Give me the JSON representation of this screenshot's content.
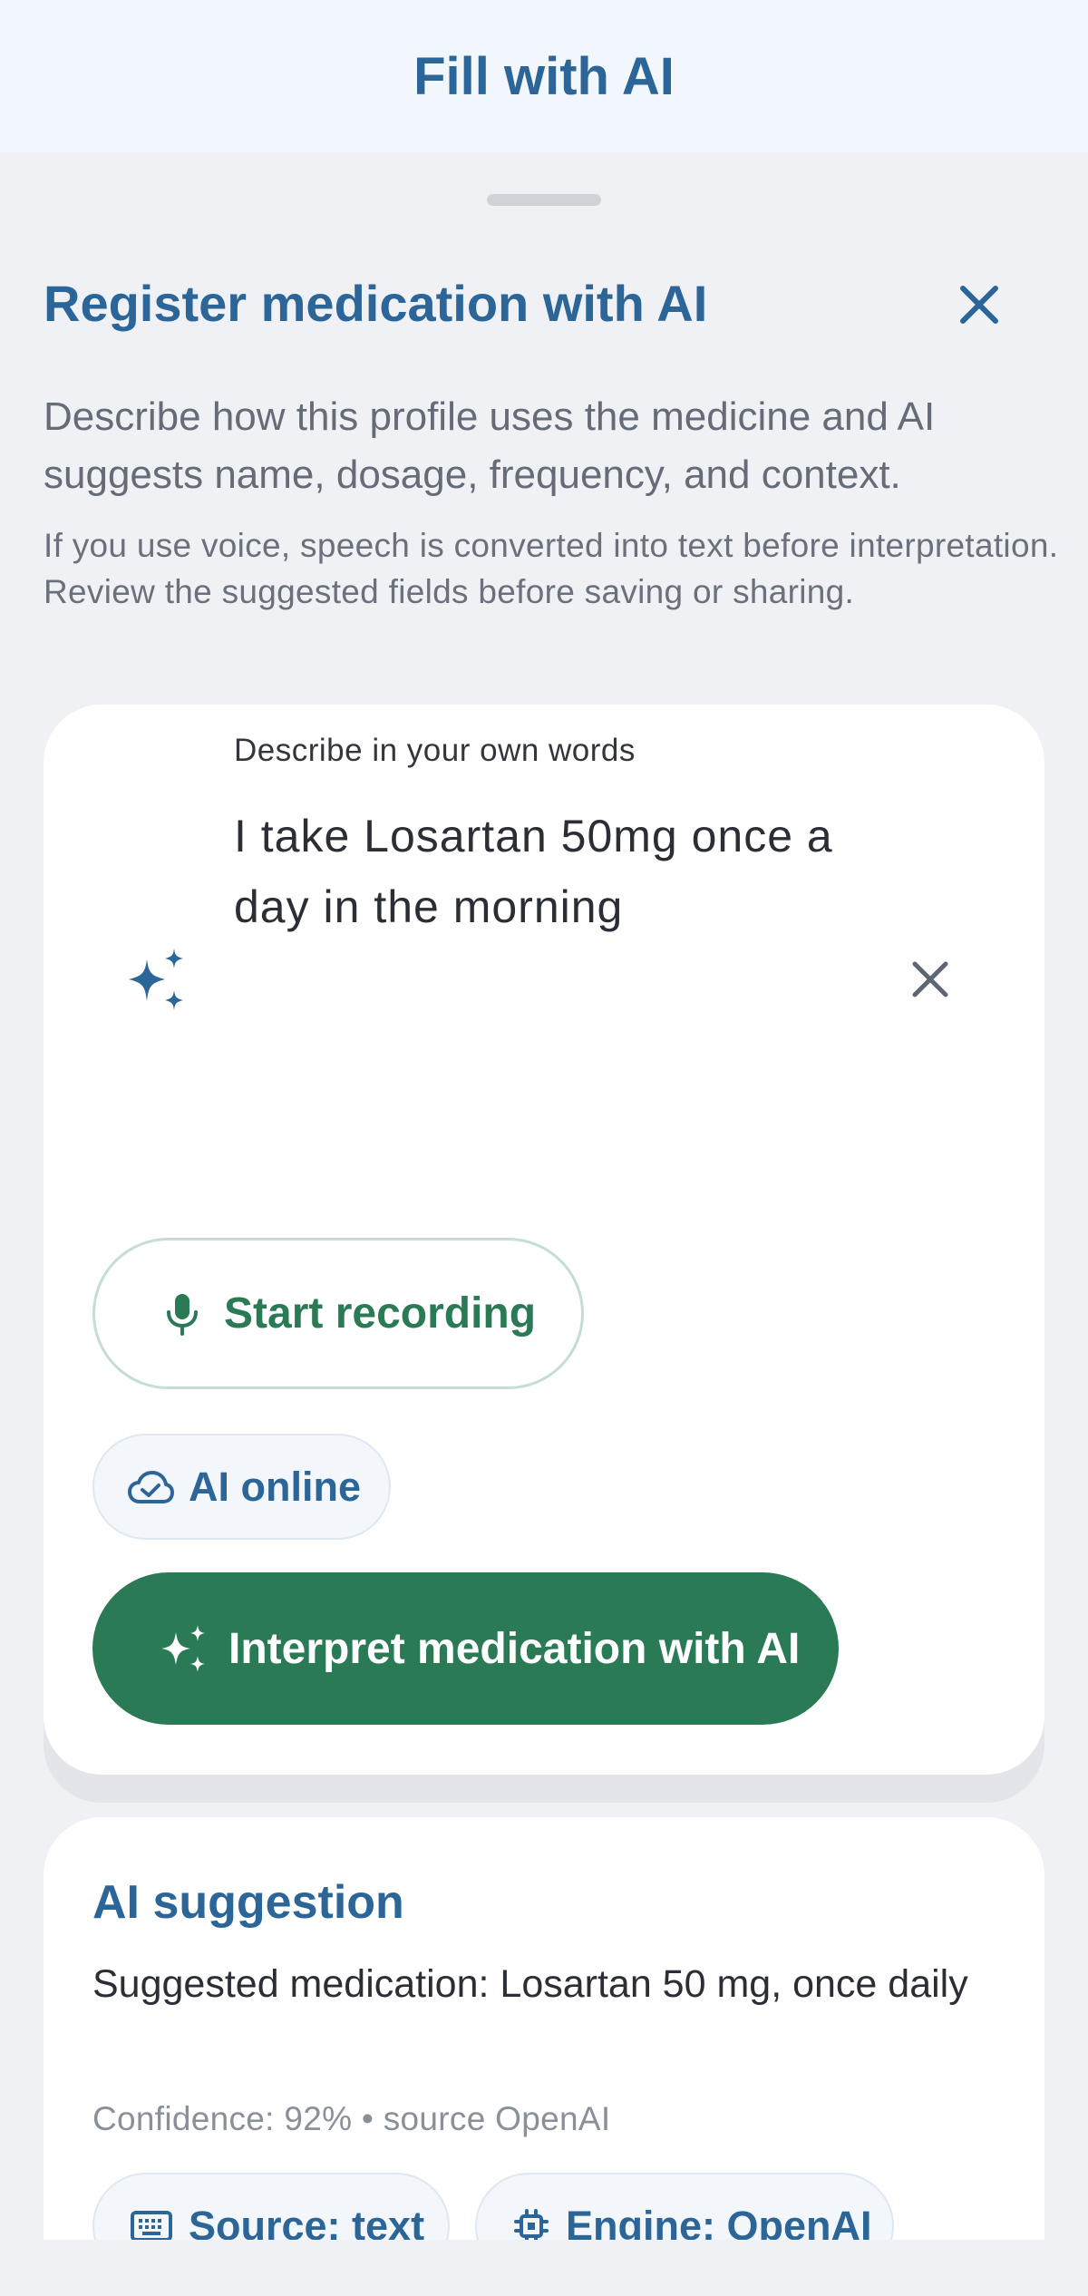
{
  "header": {
    "title": "Fill with AI"
  },
  "sheet": {
    "title": "Register medication with AI",
    "description": "Describe how this profile uses the medicine and AI suggests name, dosage, frequency, and context.",
    "note": "If you use voice, speech is converted into text before interpretation. Review the suggested fields before saving or sharing."
  },
  "input": {
    "label": "Describe in your own words",
    "value": "I take Losartan 50mg once a day in the morning"
  },
  "actions": {
    "record_label": "Start recording",
    "status_label": "AI online",
    "interpret_label": "Interpret medication with AI"
  },
  "suggestion": {
    "title": "AI suggestion",
    "text": "Suggested medication: Losartan 50 mg, once daily",
    "meta": "Confidence: 92% • source OpenAI",
    "source_chip": "Source: text",
    "engine_chip": "Engine: OpenAI"
  },
  "icons": {
    "close": "close-icon",
    "sparkle": "sparkle-icon",
    "clear": "clear-icon",
    "mic": "mic-icon",
    "cloud": "cloud-check-icon",
    "keyboard": "keyboard-icon",
    "chip": "cpu-chip-icon"
  },
  "colors": {
    "brand_blue": "#2c6597",
    "accent_green": "#2a7a56",
    "background": "#eff1f5"
  }
}
